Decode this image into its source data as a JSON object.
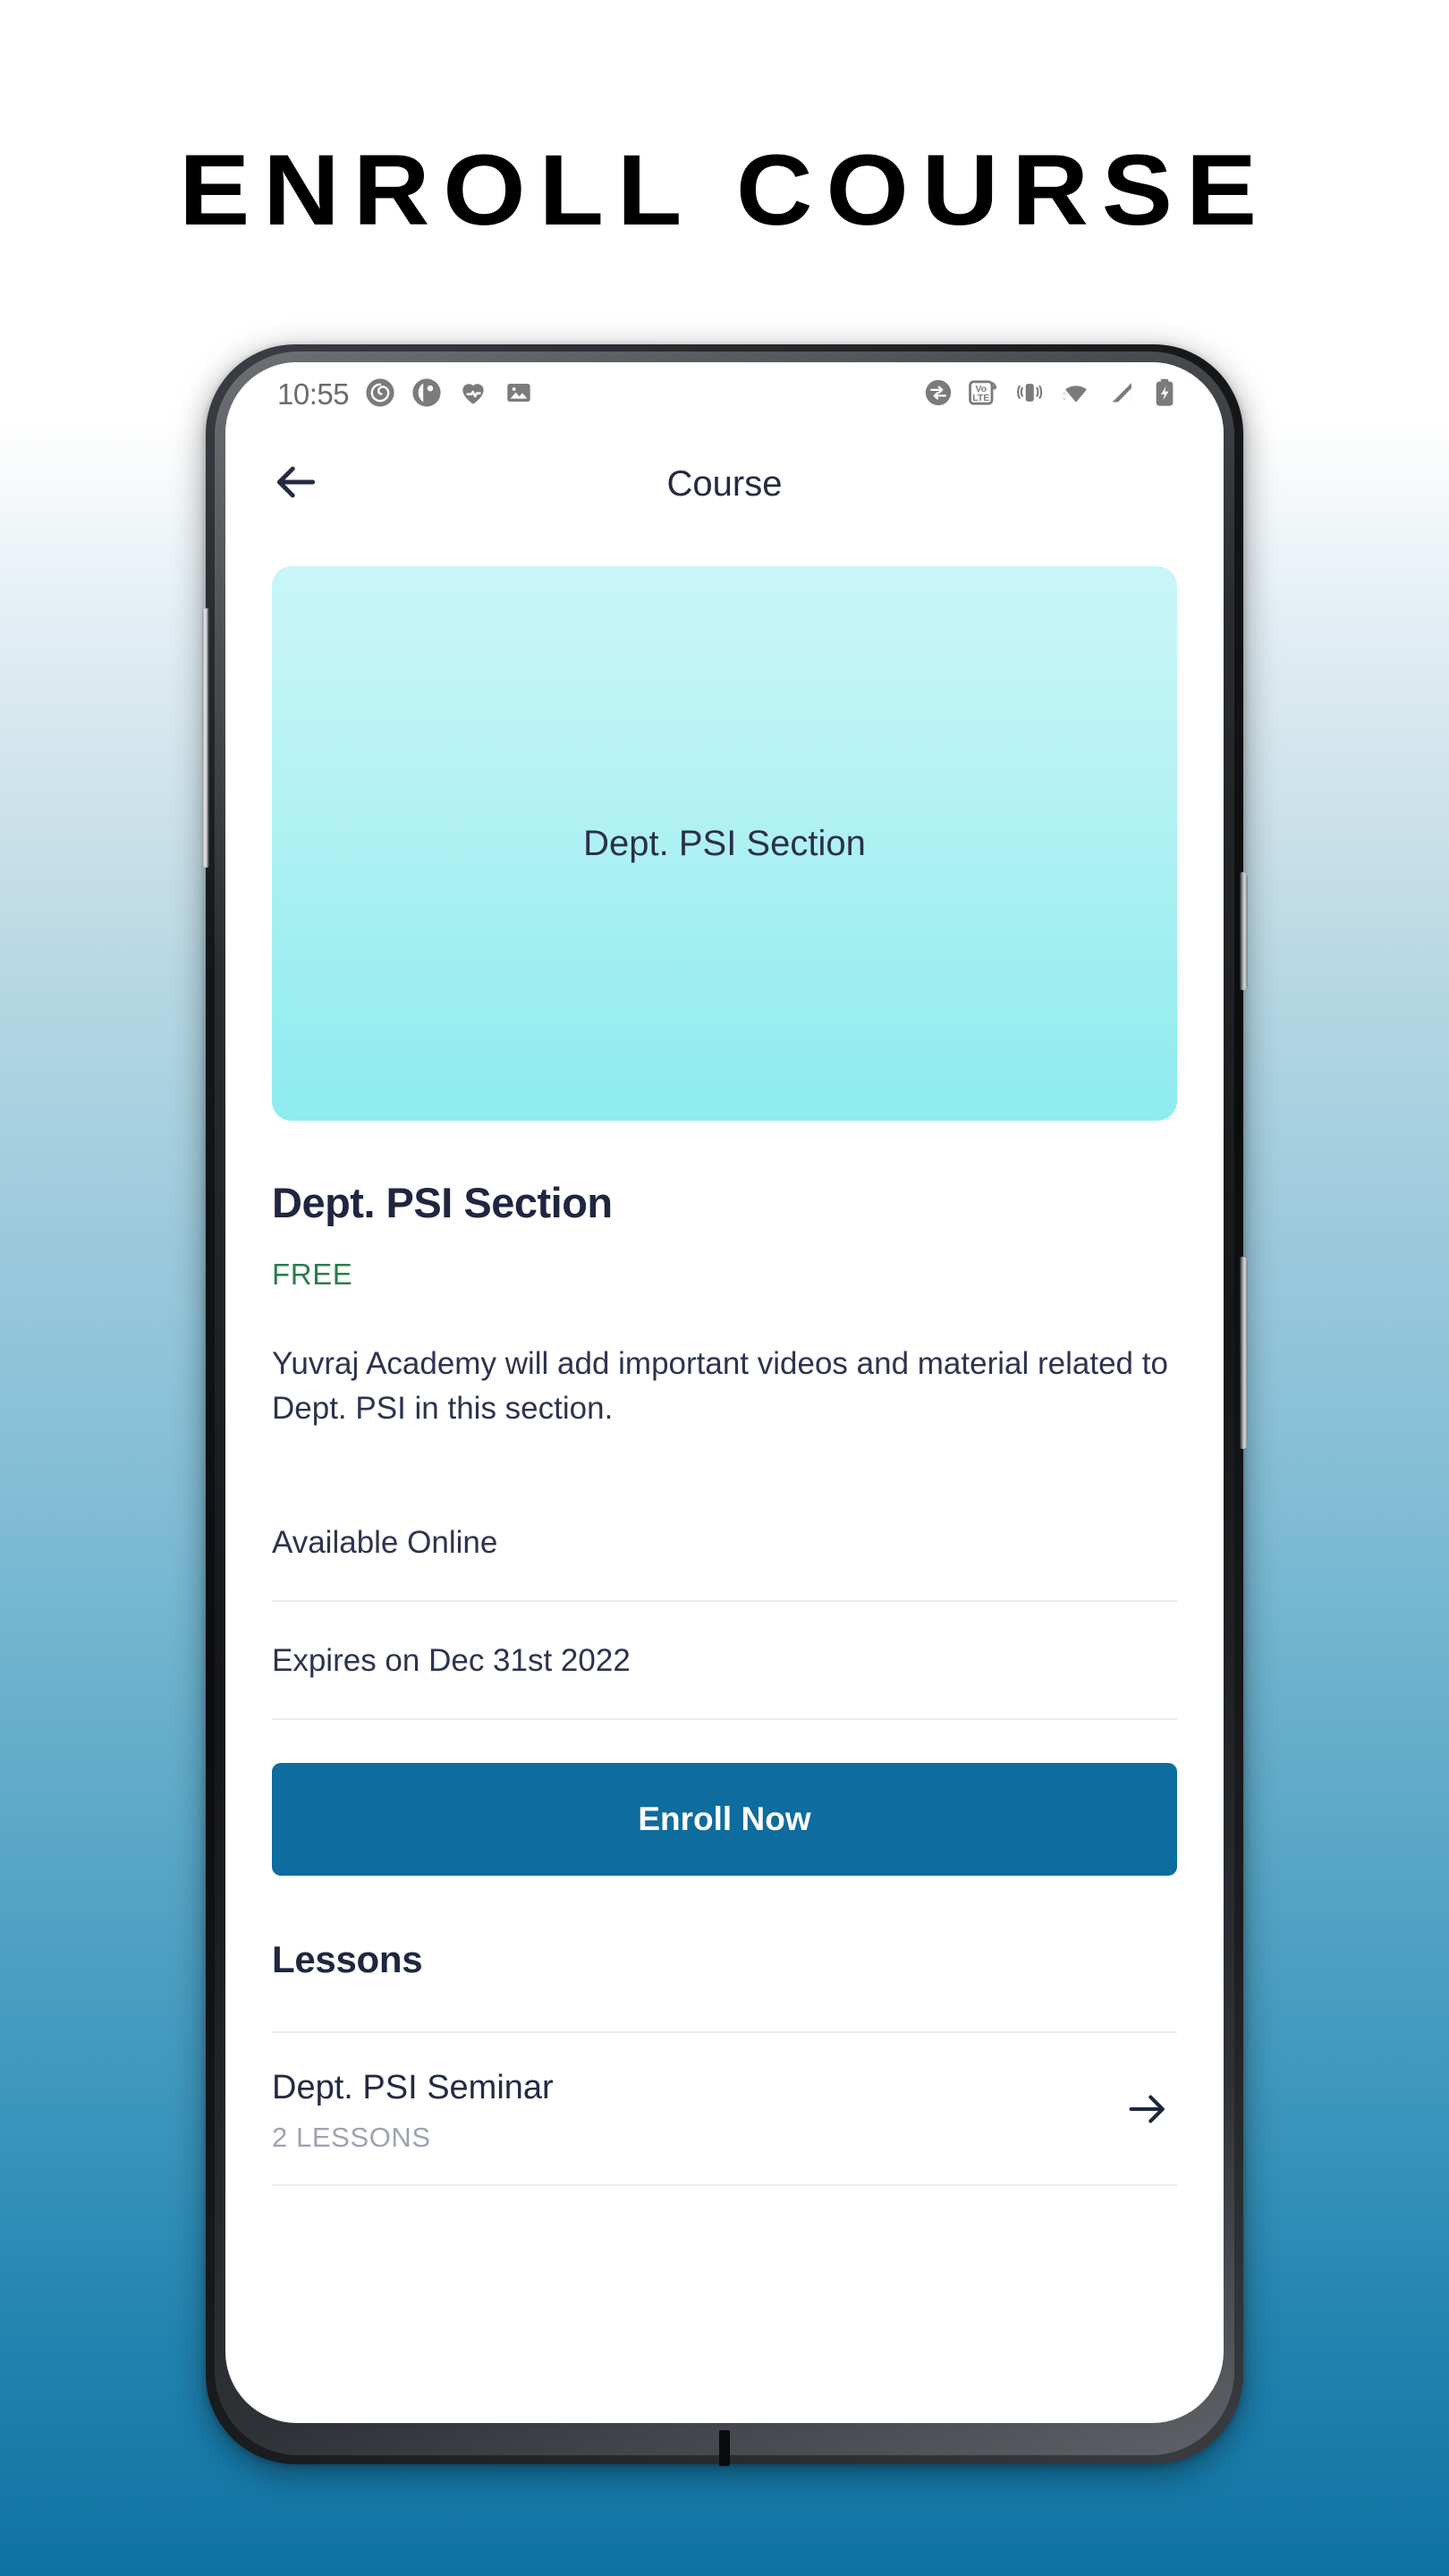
{
  "headline": "ENROLL COURSE",
  "statusbar": {
    "time": "10:55",
    "left_icons": [
      "spiral-app-icon",
      "contrast-app-icon",
      "heartbeat-icon",
      "image-icon"
    ],
    "right_icons": [
      "data-sync-icon",
      "volte-icon",
      "vibrate-icon",
      "wifi-icon",
      "signal-icon",
      "battery-charging-icon"
    ],
    "volte_label_top": "Vo",
    "volte_label_bottom": "LTE"
  },
  "appbar": {
    "back_icon": "arrow-left-icon",
    "title": "Course"
  },
  "hero": {
    "label": "Dept. PSI Section",
    "gradient_start": "#caf6f8",
    "gradient_end": "#8eecef"
  },
  "course": {
    "title": "Dept. PSI Section",
    "price": "FREE",
    "price_color": "#2d7c4d",
    "description": "Yuvraj Academy will add important videos and material related to Dept. PSI in this section.",
    "availability": "Available Online",
    "expiry": "Expires on Dec 31st 2022"
  },
  "enroll": {
    "label": "Enroll Now",
    "color": "#0e6c9e"
  },
  "lessons": {
    "heading": "Lessons",
    "items": [
      {
        "title": "Dept. PSI Seminar",
        "count": "2 LESSONS",
        "arrow_icon": "arrow-right-icon"
      }
    ]
  }
}
